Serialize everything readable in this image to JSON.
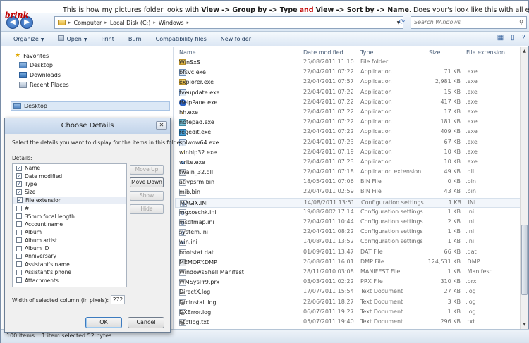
{
  "forum_text": {
    "p1": "This is how my pictures folder looks with ",
    "b1": "View -> Group by -> Type",
    "p2": " ",
    "and": "and",
    "p3": " ",
    "b2": "View -> Sort by -> Name",
    "p4": ". Does your's look like this with all extensions"
  },
  "logo": "brink",
  "address": {
    "crumbs": [
      "Computer",
      "Local Disk (C:)",
      "Windows"
    ],
    "search_placeholder": "Search Windows"
  },
  "toolbar": {
    "organize": "Organize",
    "open": "Open",
    "print": "Print",
    "burn": "Burn",
    "compat": "Compatibility files",
    "new_folder": "New folder"
  },
  "nav": {
    "favorites": "Favorites",
    "items": [
      "Desktop",
      "Downloads",
      "Recent Places"
    ],
    "desktop_root": "Desktop"
  },
  "columns": {
    "name": "Name",
    "date": "Date modified",
    "type": "Type",
    "size": "Size",
    "ext": "File extension"
  },
  "files": [
    {
      "name": "WinSxS",
      "date": "25/08/2011 11:10",
      "type": "File folder",
      "size": "",
      "ext": "",
      "icon": "folder"
    },
    {
      "name": "bfsvc.exe",
      "date": "22/04/2011 07:22",
      "type": "Application",
      "size": "71 KB",
      "ext": ".exe",
      "icon": "exe"
    },
    {
      "name": "explorer.exe",
      "date": "22/04/2011 07:57",
      "type": "Application",
      "size": "2,981 KB",
      "ext": ".exe",
      "icon": "folder"
    },
    {
      "name": "fveupdate.exe",
      "date": "22/04/2011 07:22",
      "type": "Application",
      "size": "15 KB",
      "ext": ".exe",
      "icon": "exe"
    },
    {
      "name": "HelpPane.exe",
      "date": "22/04/2011 07:22",
      "type": "Application",
      "size": "417 KB",
      "ext": ".exe",
      "icon": "help"
    },
    {
      "name": "hh.exe",
      "date": "22/04/2011 07:22",
      "type": "Application",
      "size": "17 KB",
      "ext": ".exe",
      "icon": "hh"
    },
    {
      "name": "notepad.exe",
      "date": "22/04/2011 07:22",
      "type": "Application",
      "size": "181 KB",
      "ext": ".exe",
      "icon": "note"
    },
    {
      "name": "regedit.exe",
      "date": "22/04/2011 07:22",
      "type": "Application",
      "size": "409 KB",
      "ext": ".exe",
      "icon": "reg"
    },
    {
      "name": "splwow64.exe",
      "date": "22/04/2011 07:23",
      "type": "Application",
      "size": "67 KB",
      "ext": ".exe",
      "icon": "exe"
    },
    {
      "name": "winhlp32.exe",
      "date": "22/04/2011 07:19",
      "type": "Application",
      "size": "10 KB",
      "ext": ".exe",
      "icon": "wh"
    },
    {
      "name": "write.exe",
      "date": "22/04/2011 07:23",
      "type": "Application",
      "size": "10 KB",
      "ext": ".exe",
      "icon": "wr"
    },
    {
      "name": "twain_32.dll",
      "date": "22/04/2011 07:18",
      "type": "Application extension",
      "size": "49 KB",
      "ext": ".dll",
      "icon": "dll"
    },
    {
      "name": "ativpsrm.bin",
      "date": "18/05/2011 07:06",
      "type": "BIN File",
      "size": "0 KB",
      "ext": ".bin",
      "icon": "file"
    },
    {
      "name": "mib.bin",
      "date": "22/04/2011 02:59",
      "type": "BIN File",
      "size": "43 KB",
      "ext": ".bin",
      "icon": "file"
    },
    {
      "name": "MAGIX.INI",
      "date": "14/08/2011 13:51",
      "type": "Configuration settings",
      "size": "1 KB",
      "ext": ".INI",
      "icon": "ini",
      "selected": true
    },
    {
      "name": "mgxoschk.ini",
      "date": "19/08/2002 17:14",
      "type": "Configuration settings",
      "size": "1 KB",
      "ext": ".ini",
      "icon": "ini"
    },
    {
      "name": "msdfmap.ini",
      "date": "22/04/2011 10:44",
      "type": "Configuration settings",
      "size": "2 KB",
      "ext": ".ini",
      "icon": "ini"
    },
    {
      "name": "system.ini",
      "date": "22/04/2011 08:22",
      "type": "Configuration settings",
      "size": "1 KB",
      "ext": ".ini",
      "icon": "ini"
    },
    {
      "name": "win.ini",
      "date": "14/08/2011 13:52",
      "type": "Configuration settings",
      "size": "1 KB",
      "ext": ".ini",
      "icon": "ini"
    },
    {
      "name": "bootstat.dat",
      "date": "01/09/2011 13:47",
      "type": "DAT File",
      "size": "66 KB",
      "ext": ".dat",
      "icon": "file"
    },
    {
      "name": "MEMORY.DMP",
      "date": "26/08/2011 16:01",
      "type": "DMP File",
      "size": "124,531 KB",
      "ext": ".DMP",
      "icon": "dmp"
    },
    {
      "name": "WindowsShell.Manifest",
      "date": "28/11/2010 03:08",
      "type": "MANIFEST File",
      "size": "1 KB",
      "ext": ".Manifest",
      "icon": "file"
    },
    {
      "name": "WMSysPr9.prx",
      "date": "03/03/2011 02:22",
      "type": "PRX File",
      "size": "310 KB",
      "ext": ".prx",
      "icon": "file"
    },
    {
      "name": "DirectX.log",
      "date": "17/07/2011 15:54",
      "type": "Text Document",
      "size": "27 KB",
      "ext": ".log",
      "icon": "txt"
    },
    {
      "name": "DtcInstall.log",
      "date": "22/06/2011 18:27",
      "type": "Text Document",
      "size": "3 KB",
      "ext": ".log",
      "icon": "txt"
    },
    {
      "name": "DXError.log",
      "date": "06/07/2011 19:27",
      "type": "Text Document",
      "size": "1 KB",
      "ext": ".log",
      "icon": "txt"
    },
    {
      "name": "ntbtlog.txt",
      "date": "05/07/2011 19:40",
      "type": "Text Document",
      "size": "296 KB",
      "ext": ".txt",
      "icon": "txt"
    }
  ],
  "status": {
    "count": "100 items",
    "selected": "1 item selected  52 bytes"
  },
  "dialog": {
    "title": "Choose Details",
    "instructions": "Select the details you want to display for the items in this folder.",
    "details_label": "Details:",
    "items": [
      {
        "label": "Name",
        "checked": true
      },
      {
        "label": "Date modified",
        "checked": true
      },
      {
        "label": "Type",
        "checked": true
      },
      {
        "label": "Size",
        "checked": true
      },
      {
        "label": "File extension",
        "checked": true,
        "highlighted": true
      },
      {
        "label": "#",
        "checked": false
      },
      {
        "label": "35mm focal length",
        "checked": false
      },
      {
        "label": "Account name",
        "checked": false
      },
      {
        "label": "Album",
        "checked": false
      },
      {
        "label": "Album artist",
        "checked": false
      },
      {
        "label": "Album ID",
        "checked": false
      },
      {
        "label": "Anniversary",
        "checked": false
      },
      {
        "label": "Assistant's name",
        "checked": false
      },
      {
        "label": "Assistant's phone",
        "checked": false
      },
      {
        "label": "Attachments",
        "checked": false
      }
    ],
    "btn_move_up": "Move Up",
    "btn_move_down": "Move Down",
    "btn_show": "Show",
    "btn_hide": "Hide",
    "width_label": "Width of selected column (in pixels):",
    "width_value": "272",
    "ok": "OK",
    "cancel": "Cancel"
  }
}
